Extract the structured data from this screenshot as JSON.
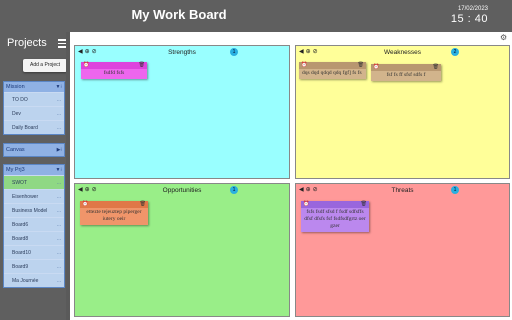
{
  "header": {
    "title": "My Work Board",
    "date": "17/02/2023",
    "time": "15 : 40"
  },
  "sidebar": {
    "title": "Projects",
    "menu_icon": "hamburger-icon",
    "add_button": "Add a Project",
    "groups": [
      {
        "name": "Mission",
        "controls": "▼⁝",
        "items": [
          "TO DO",
          "Dev",
          "Daily Board"
        ]
      },
      {
        "name": "Canvas",
        "controls": "▶⁝",
        "items": []
      },
      {
        "name": "My Prj3",
        "controls": "▼⁝",
        "items": [
          "SWOT",
          "Eisenhower",
          "Business Model",
          "Board6",
          "Board8",
          "Board10",
          "Board9",
          "Ma Journée"
        ],
        "active": "SWOT"
      }
    ],
    "item_menu": "..."
  },
  "board": {
    "settings_icon": "gear-icon",
    "tools": [
      "◀",
      "⊕",
      "⊘"
    ],
    "quadrants": [
      {
        "title": "Strengths",
        "count": "1",
        "color": "#99ffff",
        "notes": [
          {
            "text": "fsdfd fsfs",
            "color": "#ee66ee",
            "bar": "#dd44dd"
          }
        ]
      },
      {
        "title": "Weaknesses",
        "count": "2",
        "color": "#ffff99",
        "notes": [
          {
            "text": "dqs dqd qdqd qdq fgf] fs fs",
            "color": "#d2b48c",
            "bar": "#b89770"
          },
          {
            "text": "fsf fs ff sfsf sdfs f",
            "color": "#d2b48c",
            "bar": "#b89770"
          }
        ]
      },
      {
        "title": "Opportunities",
        "count": "1",
        "color": "#99ee88",
        "notes": [
          {
            "text": "ettezte tejeuztep piperger iutery oeir",
            "color": "#f0956a",
            "bar": "#e07848"
          }
        ]
      },
      {
        "title": "Threats",
        "count": "1",
        "color": "#ff9999",
        "notes": [
          {
            "text": "fsfs  fsdf sfsd f fsdf sdfsffs dfsf dfsfs fsf fsdfsdfgrtz oer gzer",
            "color": "#bb88ee",
            "bar": "#9966dd"
          }
        ]
      }
    ],
    "note_icons": {
      "left": "alarm-clock-icon",
      "right": "trash-icon"
    }
  }
}
